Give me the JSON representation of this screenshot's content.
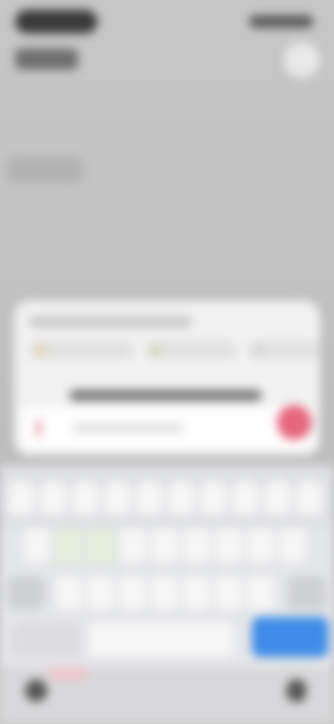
{
  "status_bar": {
    "time": "",
    "indicators": ""
  },
  "header": {
    "subtitle": ""
  },
  "composer": {
    "title": "",
    "chips": [
      "",
      "",
      ""
    ],
    "input_placeholder": "",
    "send_label": ""
  },
  "keyboard": {
    "go_label": "",
    "space_label": ""
  },
  "colors": {
    "accent_send": "#e6667d",
    "accent_go": "#3f8de8"
  }
}
